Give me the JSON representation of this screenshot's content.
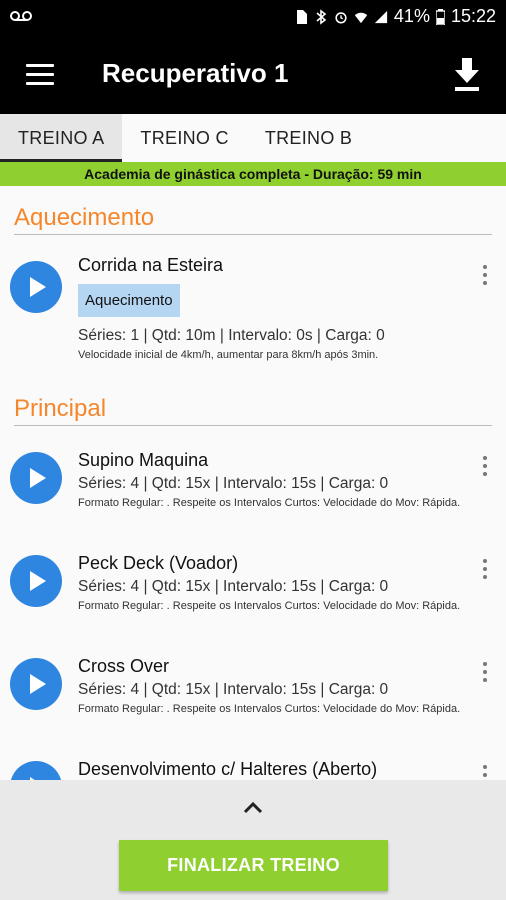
{
  "status": {
    "battery": "41%",
    "time": "15:22"
  },
  "header": {
    "title": "Recuperativo 1"
  },
  "tabs": [
    {
      "label": "TREINO A",
      "active": true
    },
    {
      "label": "TREINO C",
      "active": false
    },
    {
      "label": "TREINO B",
      "active": false
    }
  ],
  "info": "Academia de ginástica completa - Duração: 59 min",
  "sections": [
    {
      "title": "Aquecimento",
      "exercises": [
        {
          "name": "Corrida na Esteira",
          "tag": "Aquecimento",
          "meta": "Séries: 1 |  Qtd: 10m | Intervalo:  0s  | Carga: 0",
          "note": "Velocidade inicial de 4km/h, aumentar para 8km/h após 3min."
        }
      ]
    },
    {
      "title": "Principal",
      "exercises": [
        {
          "name": "Supino Maquina",
          "meta": "Séries: 4 |  Qtd: 15x | Intervalo:  15s  | Carga: 0",
          "note": "Formato Regular: . Respeite os Intervalos Curtos: Velocidade do Mov: Rápida."
        },
        {
          "name": "Peck Deck (Voador)",
          "meta": "Séries: 4 |  Qtd: 15x | Intervalo:  15s  | Carga: 0",
          "note": " Formato Regular: . Respeite os Intervalos Curtos: Velocidade do Mov: Rápida."
        },
        {
          "name": "Cross Over",
          "meta": "Séries: 4 |  Qtd: 15x | Intervalo:  15s  | Carga: 0",
          "note": "Formato Regular: . Respeite os Intervalos Curtos: Velocidade do Mov: Rápida."
        },
        {
          "name": "Desenvolvimento c/ Halteres (Aberto)"
        }
      ]
    }
  ],
  "footer": {
    "finish_label": "FINALIZAR TREINO"
  },
  "colors": {
    "accent_green": "#8fcf2f",
    "section_orange": "#f5862a",
    "play_blue": "#2f86e0",
    "tag_blue": "#b5d6f2"
  },
  "icons": [
    "voicemail-icon",
    "sim-icon",
    "bluetooth-icon",
    "alarm-icon",
    "wifi-icon",
    "signal-icon",
    "battery-icon",
    "menu-icon",
    "download-icon",
    "play-icon",
    "more-vert-icon",
    "chevron-up-icon"
  ]
}
